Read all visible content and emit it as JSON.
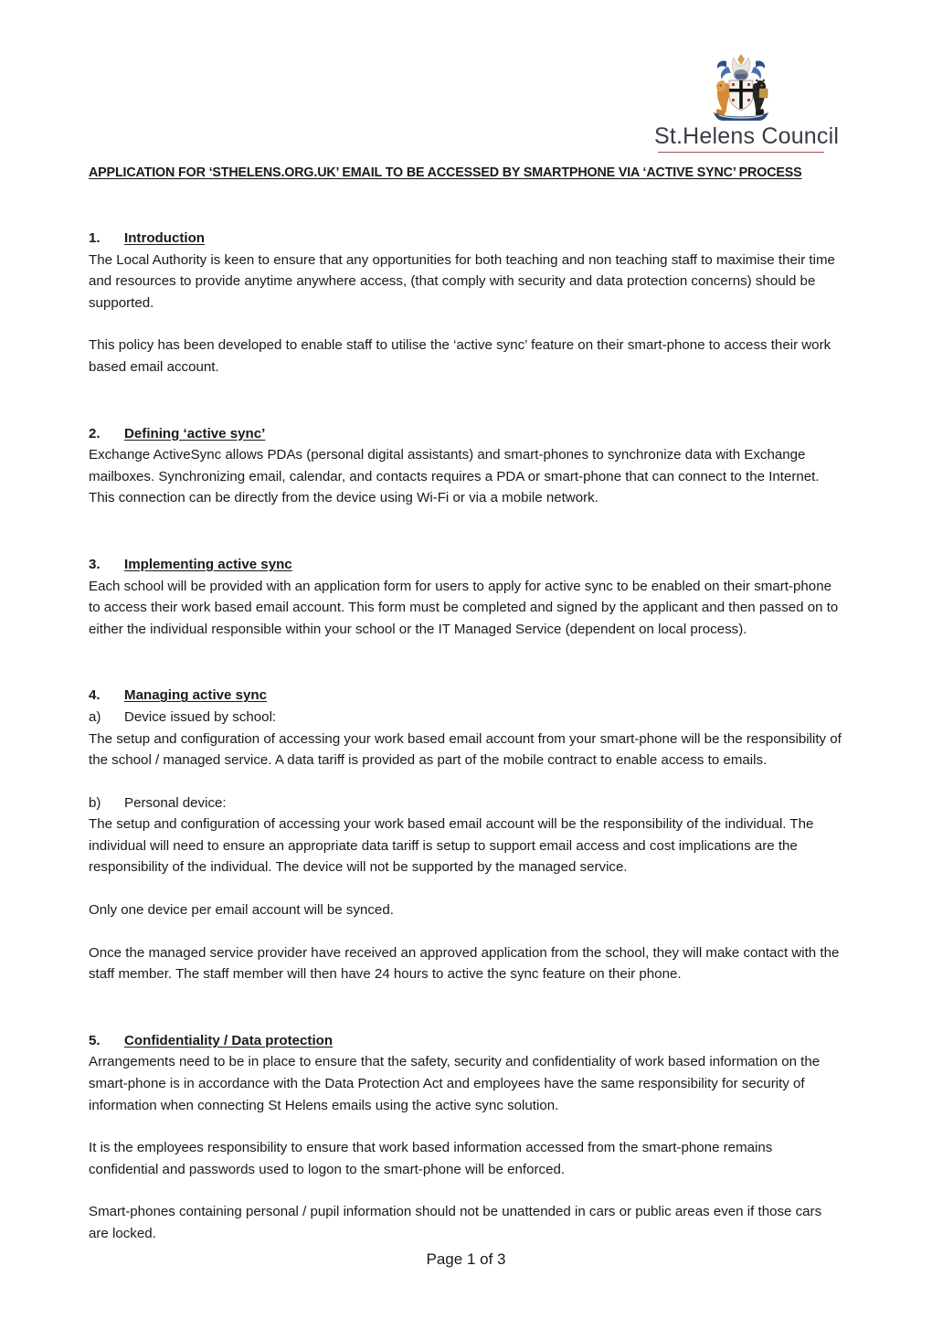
{
  "logo": {
    "crest_icon": "st-helens-coat-of-arms-icon",
    "wordmark": "St.Helens Council",
    "rule_color": "#9d4a4a"
  },
  "document": {
    "title": "APPLICATION FOR ‘STHELENS.ORG.UK’ EMAIL TO BE ACCESSED BY SMARTPHONE VIA ‘ACTIVE SYNC’ PROCESS",
    "sections": [
      {
        "number": "1.",
        "heading": "Introduction",
        "paragraphs": [
          "The Local Authority is keen to ensure that any opportunities for both teaching and non teaching staff to maximise their time and resources to provide anytime anywhere access, (that comply with security and data protection concerns) should be supported.",
          "This policy has been developed to enable staff to utilise the ‘active sync’ feature on their smart-phone to access their work based email account."
        ]
      },
      {
        "number": "2.",
        "heading": "Defining ‘active sync’",
        "paragraphs": [
          "Exchange ActiveSync allows PDAs (personal digital assistants) and smart-phones to synchronize data with Exchange mailboxes. Synchronizing email, calendar, and contacts requires a PDA or smart-phone that can connect to the Internet. This connection can be directly from the device using Wi-Fi or via a mobile network."
        ]
      },
      {
        "number": "3.",
        "heading": "Implementing active sync",
        "paragraphs": [
          "Each school will be provided with an application form for users to apply for active sync to be enabled on their smart-phone to access their work based email account.  This form must be completed and signed by the applicant and then passed on to either the individual responsible within your school or the IT Managed Service (dependent on local process)."
        ]
      },
      {
        "number": "4.",
        "heading": "Managing active sync",
        "items": [
          {
            "label": "a)",
            "text": "Device issued by school:",
            "paragraphs": [
              "The setup and configuration of accessing your work based email account from your smart-phone will be the responsibility of the school / managed service.  A data tariff is provided as part of the mobile contract to enable access to emails."
            ]
          },
          {
            "label": "b)",
            "text": "Personal device:",
            "paragraphs": [
              "The setup and configuration of accessing your work based email account will be the responsibility of the individual. The individual will need to ensure an appropriate data tariff is setup to support email access and cost implications are the responsibility of the individual.  The device will not be supported by the managed service."
            ]
          }
        ],
        "trailing_paragraphs": [
          "Only one device per email account will be synced.",
          "Once the managed service provider have received an approved application from the school, they will make contact with the staff member.  The staff member will then have 24 hours to active the sync feature on their phone."
        ]
      },
      {
        "number": "5.",
        "heading": "Confidentiality / Data protection",
        "paragraphs": [
          "Arrangements need to be in place to ensure that the safety, security and confidentiality of work based information on the smart-phone is in accordance with the Data Protection Act and employees have the same responsibility for security of information when connecting St Helens emails using the active sync solution.",
          "It is the employees responsibility to ensure that work based information accessed from the smart-phone remains confidential and passwords used to logon to the smart-phone will be enforced.",
          "Smart-phones containing personal / pupil information should not be unattended in cars or public areas even if those cars are locked."
        ]
      }
    ]
  },
  "footer": {
    "page_label": "Page 1 of 3"
  }
}
